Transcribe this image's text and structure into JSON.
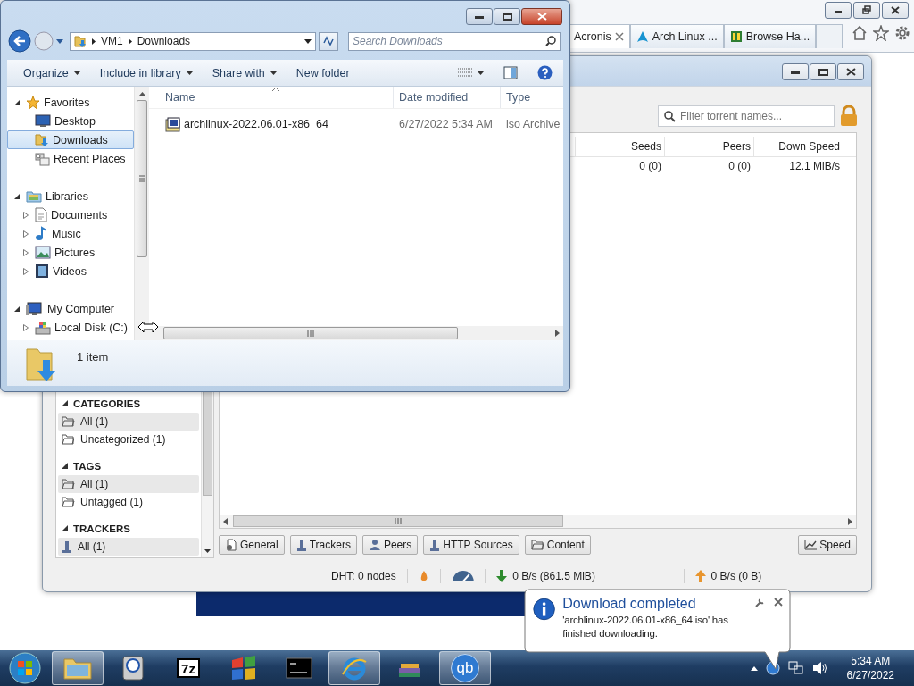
{
  "browser": {
    "tabs": [
      {
        "label": "Acronis",
        "selected": true
      },
      {
        "label": "Arch Linux ...",
        "selected": false
      },
      {
        "label": "Browse Ha...",
        "selected": false
      }
    ]
  },
  "qbittorrent": {
    "filter": {
      "placeholder": "Filter torrent names..."
    },
    "columns": [
      "Seeds",
      "Peers",
      "Down Speed"
    ],
    "rows": [
      {
        "cells": [
          "0 (0)",
          "0 (0)",
          "12.1 MiB/s"
        ]
      }
    ],
    "sidebar": [
      {
        "title": "CATEGORIES",
        "expanded": true,
        "items": [
          {
            "label": "All (1)",
            "kind": "folder",
            "selected": true
          },
          {
            "label": "Uncategorized (1)",
            "kind": "folder",
            "selected": false
          }
        ]
      },
      {
        "title": "TAGS",
        "expanded": true,
        "items": [
          {
            "label": "All (1)",
            "kind": "folder",
            "selected": true
          },
          {
            "label": "Untagged (1)",
            "kind": "folder",
            "selected": false
          }
        ]
      },
      {
        "title": "TRACKERS",
        "expanded": true,
        "items": [
          {
            "label": "All (1)",
            "kind": "tracker",
            "selected": true
          }
        ]
      }
    ],
    "detail_tabs": [
      {
        "label": "General",
        "kind": "general"
      },
      {
        "label": "Trackers",
        "kind": "trackers"
      },
      {
        "label": "Peers",
        "kind": "peers"
      },
      {
        "label": "HTTP Sources",
        "kind": "sources"
      },
      {
        "label": "Content",
        "kind": "content"
      }
    ],
    "speed_button": "Speed",
    "status_bar": {
      "dht": "DHT: 0 nodes",
      "download": "0 B/s (861.5 MiB)",
      "upload": "0 B/s (0 B)"
    }
  },
  "explorer": {
    "path": [
      "VM1",
      "Downloads"
    ],
    "search": {
      "placeholder": "Search Downloads"
    },
    "commands": [
      {
        "label": "Organize",
        "dropdown": true
      },
      {
        "label": "Include in library",
        "dropdown": true
      },
      {
        "label": "Share with",
        "dropdown": true
      },
      {
        "label": "New folder",
        "dropdown": false
      }
    ],
    "nav": [
      {
        "label": "Favorites",
        "kind": "favorites",
        "expanded": true,
        "selected": false,
        "children": [
          {
            "label": "Desktop",
            "kind": "desktop",
            "selected": false
          },
          {
            "label": "Downloads",
            "kind": "downloads",
            "selected": true
          },
          {
            "label": "Recent Places",
            "kind": "recent",
            "selected": false
          }
        ]
      },
      {
        "label": "Libraries",
        "kind": "libraries",
        "expanded": true,
        "selected": false,
        "children": [
          {
            "label": "Documents",
            "kind": "documents",
            "expanded": false,
            "selected": false
          },
          {
            "label": "Music",
            "kind": "music",
            "expanded": false,
            "selected": false
          },
          {
            "label": "Pictures",
            "kind": "pictures",
            "expanded": false,
            "selected": false
          },
          {
            "label": "Videos",
            "kind": "videos",
            "expanded": false,
            "selected": false
          }
        ]
      },
      {
        "label": "My Computer",
        "kind": "computer",
        "expanded": true,
        "selected": false,
        "children": [
          {
            "label": "Local Disk (C:)",
            "kind": "disk",
            "expanded": false,
            "selected": false
          }
        ]
      }
    ],
    "columns": [
      "Name",
      "Date modified",
      "Type"
    ],
    "files": [
      {
        "name": "archlinux-2022.06.01-x86_64",
        "date": "6/27/2022 5:34 AM",
        "type": "iso Archive"
      }
    ],
    "status": "1 item"
  },
  "notification": {
    "title": "Download completed",
    "message": "'archlinux-2022.06.01-x86_64.iso' has finished downloading."
  },
  "taskbar": {
    "apps": [
      {
        "kind": "explorer",
        "running": true
      },
      {
        "kind": "disk-tool",
        "running": false
      },
      {
        "kind": "archiver",
        "label": "7z",
        "running": false
      },
      {
        "kind": "flag",
        "running": false
      },
      {
        "kind": "console",
        "running": false
      },
      {
        "kind": "browser",
        "running": true
      },
      {
        "kind": "books",
        "running": false
      },
      {
        "kind": "torrent",
        "label": "qb",
        "running": true
      }
    ],
    "clock": {
      "time": "5:34 AM",
      "date": "6/27/2022"
    }
  }
}
